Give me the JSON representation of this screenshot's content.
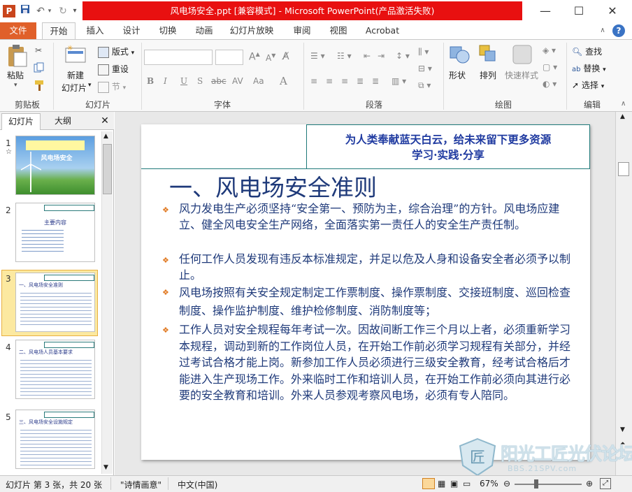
{
  "window": {
    "title": "风电场安全.ppt [兼容模式] - Microsoft PowerPoint(产品激活失败)",
    "app_icon": "P",
    "controls": {
      "minimize": "—",
      "maximize": "☐",
      "close": "✕"
    }
  },
  "tabs": [
    "文件",
    "开始",
    "插入",
    "设计",
    "切换",
    "动画",
    "幻灯片放映",
    "审阅",
    "视图",
    "Acrobat"
  ],
  "ribbon": {
    "clipboard": {
      "paste": "粘贴",
      "label": "剪贴板"
    },
    "slides": {
      "new_slide": "新建",
      "new_slide2": "幻灯片",
      "layout": "版式",
      "reset": "重设",
      "section": "节",
      "label": "幻灯片"
    },
    "font": {
      "label": "字体",
      "bold": "B",
      "italic": "I",
      "underline": "U",
      "strike": "S",
      "abc": "abc",
      "av": "AV",
      "aa": "Aa",
      "a": "A"
    },
    "paragraph": {
      "label": "段落"
    },
    "drawing": {
      "shape": "形状",
      "arrange": "排列",
      "quick_style": "快速样式",
      "label": "绘图"
    },
    "editing": {
      "find": "查找",
      "replace": "替换",
      "select": "选择",
      "label": "编辑"
    }
  },
  "thumb_tabs": {
    "slides": "幻灯片",
    "outline": "大纲"
  },
  "thumbnails": [
    {
      "num": "1",
      "star": "☆",
      "title": "风电场安全"
    },
    {
      "num": "2",
      "title": "主要内容"
    },
    {
      "num": "3",
      "title": "一、风电场安全准则"
    },
    {
      "num": "4",
      "title": "二、风电场人员基本要求"
    },
    {
      "num": "5",
      "title": "三、风电场安全设施规定"
    }
  ],
  "slide": {
    "header_line1": "为人类奉献蓝天白云，给未来留下更多资源",
    "header_line2": "学习·实践·分享",
    "title": "一、风电场安全准则",
    "bullets": [
      "风力发电生产必须坚持“安全第一、预防为主，综合治理”的方针。风电场应建立、健全风电安全生产网络，全面落实第一责任人的安全生产责任制。",
      "任何工作人员发现有违反本标准规定，并足以危及人身和设备安全者必须予以制止。",
      "风电场按照有关安全规定制定工作票制度、操作票制度、交接班制度、巡回检查制度、操作监护制度、维护检修制度、消防制度等；",
      "工作人员对安全规程每年考试一次。因故间断工作三个月以上者，必须重新学习本规程，调动到新的工作岗位人员，在开始工作前必须学习规程有关部分，并经过考试合格才能上岗。新参加工作人员必须进行三级安全教育，经考试合格后才能进入生产现场工作。外来临时工作和培训人员，在开始工作前必须向其进行必要的安全教育和培训。外来人员参观考察风电场，必须有专人陪同。"
    ]
  },
  "statusbar": {
    "slide_info": "幻灯片 第 3 张，共 20 张",
    "theme": "\"诗情画意\"",
    "language": "中文(中国)",
    "zoom": "67%"
  },
  "watermark": {
    "brand": "阳光工匠光伏论坛",
    "url": "BBS.21SPV.com"
  }
}
